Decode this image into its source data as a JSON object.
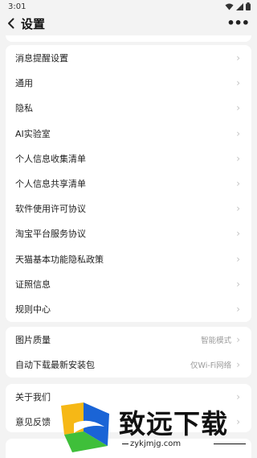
{
  "status_bar": {
    "time": "3:01"
  },
  "header": {
    "title": "设置"
  },
  "section1": {
    "items": [
      {
        "label": "消息提醒设置"
      },
      {
        "label": "通用"
      },
      {
        "label": "隐私"
      },
      {
        "label": "AI实验室"
      },
      {
        "label": "个人信息收集清单"
      },
      {
        "label": "个人信息共享清单"
      },
      {
        "label": "软件使用许可协议"
      },
      {
        "label": "淘宝平台服务协议"
      },
      {
        "label": "天猫基本功能隐私政策"
      },
      {
        "label": "证照信息"
      },
      {
        "label": "规则中心"
      }
    ]
  },
  "section2": {
    "items": [
      {
        "label": "图片质量",
        "value": "智能模式"
      },
      {
        "label": "自动下载最新安装包",
        "value": "仅Wi-Fi网络"
      }
    ]
  },
  "section3": {
    "items": [
      {
        "label": "关于我们"
      },
      {
        "label": "意见反馈"
      }
    ]
  },
  "watermark": {
    "text": "致远下载",
    "url": "zykjmjg.com"
  },
  "colors": {
    "background": "#f3f3f3",
    "card": "#ffffff",
    "chevron": "#c2c2c2",
    "value_text": "#9a9a9a"
  }
}
